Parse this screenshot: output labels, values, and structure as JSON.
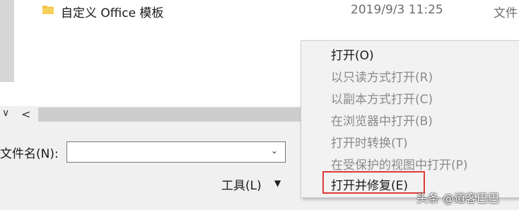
{
  "file_list": {
    "rows": [
      {
        "name": "自定义 Office 模板",
        "date": "2019/9/3 11:25",
        "type": "文件",
        "icon": "folder-icon"
      }
    ]
  },
  "scrollbar": {
    "left_arrow": "<",
    "left_chevron": "∨"
  },
  "filename": {
    "label": "文件名(N):",
    "value": ""
  },
  "tools": {
    "label": "工具(L)",
    "arrow": "▼"
  },
  "open_menu": {
    "items": [
      {
        "label": "打开(O)",
        "enabled": true
      },
      {
        "label": "以只读方式打开(R)",
        "enabled": false
      },
      {
        "label": "以副本方式打开(C)",
        "enabled": false
      },
      {
        "label": "在浏览器中打开(B)",
        "enabled": false
      },
      {
        "label": "打开时转换(T)",
        "enabled": false
      },
      {
        "label": "在受保护的视图中打开(P)",
        "enabled": false
      },
      {
        "label": "打开并修复(E)",
        "enabled": true,
        "highlighted": true
      }
    ]
  },
  "watermark": {
    "text": "头条 @道客巴巴"
  },
  "colors": {
    "highlight_border": "#e03a3a",
    "menu_bg": "#f2f2f2",
    "folder": "#f4c542"
  }
}
